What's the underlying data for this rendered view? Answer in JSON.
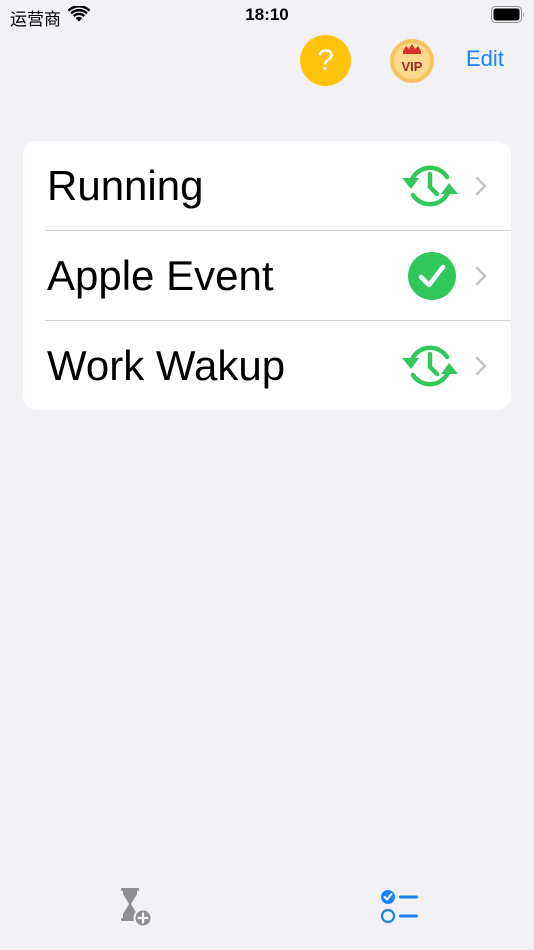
{
  "status_bar": {
    "carrier": "运营商",
    "time": "18:10"
  },
  "nav": {
    "help_label": "?",
    "vip_label": "VIP",
    "edit_label": "Edit"
  },
  "timers": [
    {
      "label": "Running",
      "status_icon": "repeat-clock-icon"
    },
    {
      "label": "Apple Event",
      "status_icon": "checkmark-circle-icon"
    },
    {
      "label": "Work Wakup",
      "status_icon": "repeat-clock-icon"
    }
  ],
  "tabs": [
    {
      "icon": "hourglass-add-icon",
      "selected": false
    },
    {
      "icon": "checklist-icon",
      "selected": true
    }
  ],
  "colors": {
    "accent": "#1a82fb",
    "success": "#32c75a",
    "help": "#fec30a",
    "background": "#f2f1f6"
  }
}
